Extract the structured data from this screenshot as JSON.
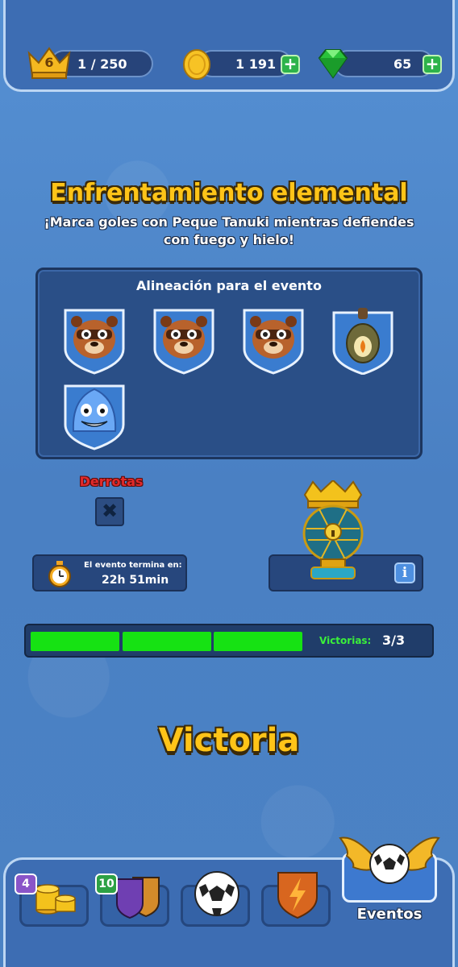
{
  "resources": {
    "level": "6",
    "level_progress": "1 / 250",
    "coins": "1 191",
    "gems": "65"
  },
  "event": {
    "title": "Enfrentamiento elemental",
    "subtitle": "¡Marca goles con Peque Tanuki mientras defiendes con fuego y hielo!",
    "lineup_title": "Alineación para el evento",
    "lineup": [
      "tanuki-icon",
      "tanuki-icon",
      "tanuki-icon",
      "fire-bottle-icon",
      "ice-spirit-icon"
    ],
    "defeats_label": "Derrotas",
    "timer_label": "El evento termina en:",
    "timer_value": "22h 51min",
    "victories_label": "Victorias:",
    "victories_value": "3/3",
    "victories_progress": 1.0,
    "result": "Victoria"
  },
  "nav": {
    "tabs": [
      {
        "icon": "coins-stack-icon",
        "badge": "4"
      },
      {
        "icon": "cards-icon",
        "badge": "10"
      },
      {
        "icon": "soccer-ball-icon",
        "badge": ""
      },
      {
        "icon": "shield-bolt-icon",
        "badge": ""
      }
    ],
    "active_label": "Eventos"
  },
  "colors": {
    "accent_yellow": "#ffc418",
    "progress_green": "#16e213",
    "defeat_red": "#e22a2a",
    "panel_blue": "#2a4f87"
  }
}
